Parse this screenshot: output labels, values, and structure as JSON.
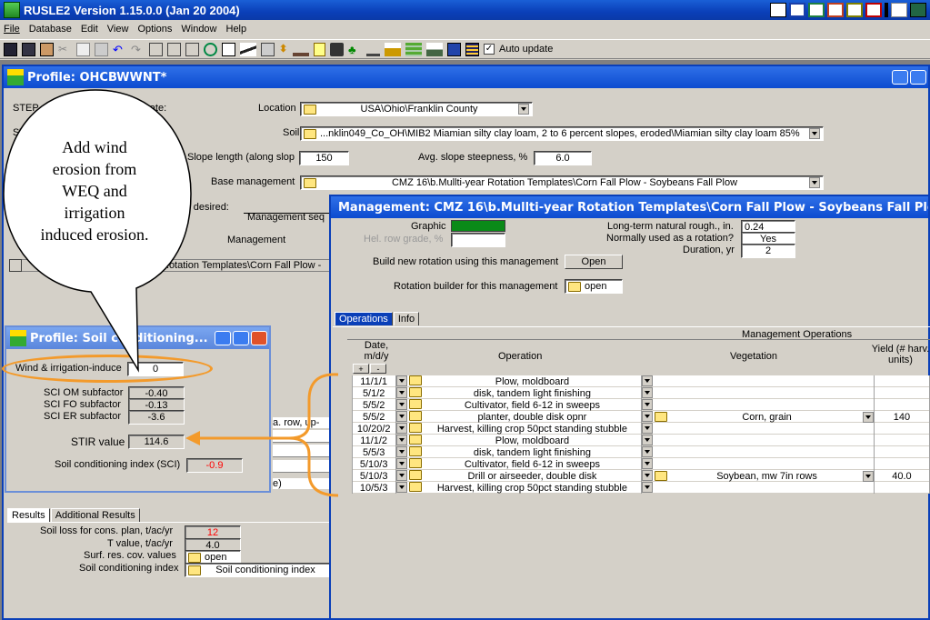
{
  "app": {
    "title": "RUSLE2 Version 1.15.0.0 (Jan 20 2004)"
  },
  "menu": [
    "File",
    "Database",
    "Edit",
    "View",
    "Options",
    "Window",
    "Help"
  ],
  "toolbar": {
    "auto_update_label": "Auto update",
    "auto_update_checked": true
  },
  "profile": {
    "title": "Profile:  OHCBWWNT*",
    "step1": "STEP 1: Click folder to set climate:",
    "step2": "STEP 2:",
    "location_label": "Location",
    "location_value": "USA\\Ohio\\Franklin County",
    "soil_label": "Soil",
    "soil_value": "...nklin049_Co_OH\\MIB2 Miamian silty clay loam, 2 to 6 percent slopes, eroded\\Miamian silty clay loam 85%",
    "slope_length_label": "Slope length (along slop",
    "slope_length_value": "150",
    "slope_steep_label": "Avg. slope steepness, %",
    "slope_steep_value": "6.0",
    "base_mgmt_label": "Base management",
    "base_mgmt_value": "CMZ 16\\b.Mullti-year Rotation Templates\\Corn Fall Plow - Soybeans Fall Plow",
    "if_desired": "e if desired:",
    "mgmt_seq_label": "Management seq",
    "mgmt_col_label": "Management",
    "mgmt_row_value": "Rotation Templates\\Corn Fall Plow -",
    "row_text_1": "a. row, up-",
    "row_text_2": "e)",
    "results_tab": "Results",
    "additional_results_tab": "Additional Results",
    "soil_loss_label": "Soil loss for cons. plan, t/ac/yr",
    "soil_loss_value": "12",
    "t_value_label": "T value, t/ac/yr",
    "t_value_value": "4.0",
    "surf_res_label": "Surf. res. cov. values",
    "surf_res_value": "open",
    "sci_label": "Soil conditioning index",
    "sci_value": "Soil conditioning index"
  },
  "callout": {
    "text": "Add wind erosion from WEQ and irrigation induced erosion."
  },
  "soilcond": {
    "title": "Profile:  Soil conditioning...",
    "wind_label": "Wind & irrigation-induce",
    "wind_value": "0",
    "om_label": "SCI OM subfactor",
    "om_value": "-0.40",
    "fo_label": "SCI FO subfactor",
    "fo_value": "-0.13",
    "er_label": "SCI ER subfactor",
    "er_value": "-3.6",
    "stir_label": "STIR value",
    "stir_value": "114.6",
    "sci_label": "Soil conditioning index (SCI)",
    "sci_value": "-0.9"
  },
  "mgmt": {
    "title": "Management:  CMZ 16\\b.Mullti-year Rotation Templates\\Corn Fall Plow - Soybeans Fall Plow",
    "graphic_label": "Graphic",
    "hel_label": "Hel. row grade, %",
    "rough_label": "Long-term natural rough., in.",
    "rough_value": "0.24",
    "rotation_label": "Normally used as a rotation?",
    "rotation_value": "Yes",
    "duration_label": "Duration, yr",
    "duration_value": "2",
    "build_label": "Build new rotation using this management",
    "build_btn": "Open",
    "builder_label": "Rotation builder for this management",
    "builder_btn": "open",
    "tab_ops": "Operations",
    "tab_info": "Info",
    "grid_title": "Management Operations",
    "col_date": "Date, m/d/y",
    "col_op": "Operation",
    "col_veg": "Vegetation",
    "col_yield": "Yield (# harv. units)",
    "plus": "+",
    "minus": "-",
    "rows": [
      {
        "date": "11/1/1",
        "op": "Plow, moldboard",
        "veg": "",
        "yield": ""
      },
      {
        "date": "5/1/2",
        "op": "disk, tandem light finishing",
        "veg": "",
        "yield": ""
      },
      {
        "date": "5/5/2",
        "op": "Cultivator, field 6-12 in sweeps",
        "veg": "",
        "yield": ""
      },
      {
        "date": "5/5/2",
        "op": "planter, double disk opnr",
        "veg": "Corn, grain",
        "yield": "140"
      },
      {
        "date": "10/20/2",
        "op": "Harvest, killing crop 50pct standing stubble",
        "veg": "",
        "yield": ""
      },
      {
        "date": "11/1/2",
        "op": "Plow, moldboard",
        "veg": "",
        "yield": ""
      },
      {
        "date": "5/5/3",
        "op": "disk, tandem light finishing",
        "veg": "",
        "yield": ""
      },
      {
        "date": "5/10/3",
        "op": "Cultivator, field 6-12 in sweeps",
        "veg": "",
        "yield": ""
      },
      {
        "date": "5/10/3",
        "op": "Drill or airseeder, double disk",
        "veg": "Soybean, mw 7in rows",
        "yield": "40.0"
      },
      {
        "date": "10/5/3",
        "op": "Harvest, killing crop 50pct standing stubble",
        "veg": "",
        "yield": ""
      }
    ]
  },
  "colors": {
    "accent_orange": "#f39a2b",
    "titlebar_blue": "#0a3fb8",
    "soil_loss_red": "#ff0000",
    "sci_red": "#ff0000"
  }
}
